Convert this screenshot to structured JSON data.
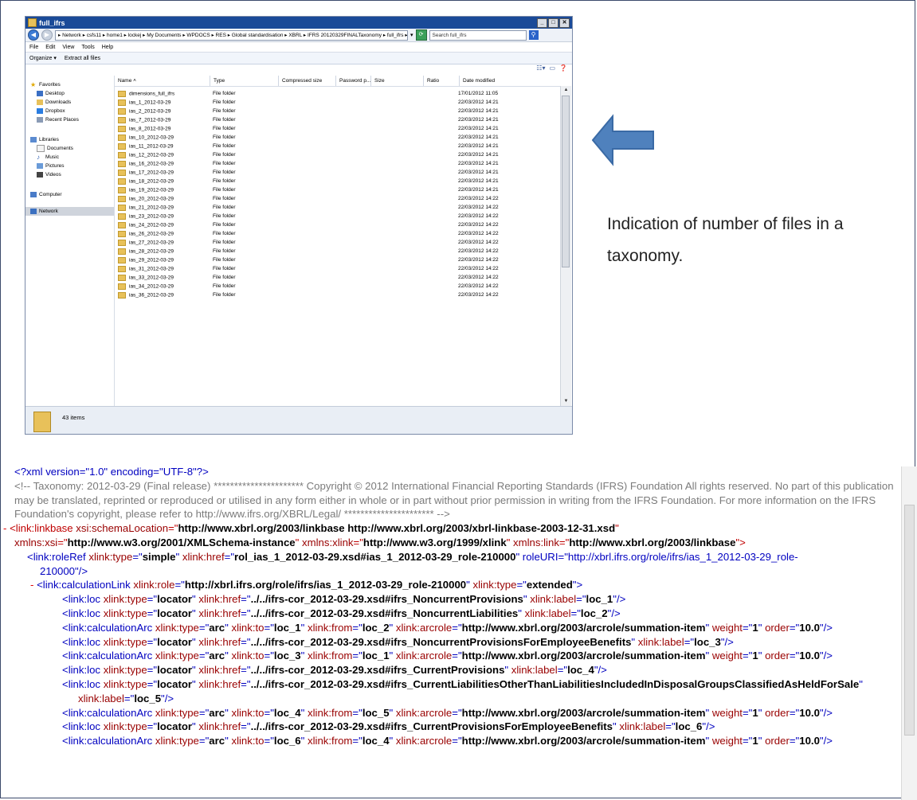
{
  "explorer": {
    "title": "full_ifrs",
    "address": "▸ Network ▸ csfs11 ▸ home1 ▸ lockej ▸ My Documents ▸ WPDOCS ▸ RES ▸ Global standardisation ▸ XBRL ▸ IFRS 20120329FINALTaxonomy ▸ full_ifrs ▸",
    "search_placeholder": "Search full_ifrs",
    "menu": [
      "File",
      "Edit",
      "View",
      "Tools",
      "Help"
    ],
    "toolbar": {
      "organize": "Organize ▾",
      "extract": "Extract all files"
    },
    "nav": {
      "favorites": "Favorites",
      "fav_items": [
        "Desktop",
        "Downloads",
        "Dropbox",
        "Recent Places"
      ],
      "libraries": "Libraries",
      "lib_items": [
        "Documents",
        "Music",
        "Pictures",
        "Videos"
      ],
      "computer": "Computer",
      "network": "Network"
    },
    "columns": [
      "Name ˄",
      "Type",
      "Compressed size",
      "Password p...",
      "Size",
      "Ratio",
      "Date modified"
    ],
    "files": [
      {
        "name": "dimensions_full_ifrs",
        "type": "File folder",
        "date": "17/01/2012 11:05"
      },
      {
        "name": "ias_1_2012-03-29",
        "type": "File folder",
        "date": "22/03/2012 14:21"
      },
      {
        "name": "ias_2_2012-03-29",
        "type": "File folder",
        "date": "22/03/2012 14:21"
      },
      {
        "name": "ias_7_2012-03-29",
        "type": "File folder",
        "date": "22/03/2012 14:21"
      },
      {
        "name": "ias_8_2012-03-29",
        "type": "File folder",
        "date": "22/03/2012 14:21"
      },
      {
        "name": "ias_10_2012-03-29",
        "type": "File folder",
        "date": "22/03/2012 14:21"
      },
      {
        "name": "ias_11_2012-03-29",
        "type": "File folder",
        "date": "22/03/2012 14:21"
      },
      {
        "name": "ias_12_2012-03-29",
        "type": "File folder",
        "date": "22/03/2012 14:21"
      },
      {
        "name": "ias_16_2012-03-29",
        "type": "File folder",
        "date": "22/03/2012 14:21"
      },
      {
        "name": "ias_17_2012-03-29",
        "type": "File folder",
        "date": "22/03/2012 14:21"
      },
      {
        "name": "ias_18_2012-03-29",
        "type": "File folder",
        "date": "22/03/2012 14:21"
      },
      {
        "name": "ias_19_2012-03-29",
        "type": "File folder",
        "date": "22/03/2012 14:21"
      },
      {
        "name": "ias_20_2012-03-29",
        "type": "File folder",
        "date": "22/03/2012 14:22"
      },
      {
        "name": "ias_21_2012-03-29",
        "type": "File folder",
        "date": "22/03/2012 14:22"
      },
      {
        "name": "ias_23_2012-03-29",
        "type": "File folder",
        "date": "22/03/2012 14:22"
      },
      {
        "name": "ias_24_2012-03-29",
        "type": "File folder",
        "date": "22/03/2012 14:22"
      },
      {
        "name": "ias_26_2012-03-29",
        "type": "File folder",
        "date": "22/03/2012 14:22"
      },
      {
        "name": "ias_27_2012-03-29",
        "type": "File folder",
        "date": "22/03/2012 14:22"
      },
      {
        "name": "ias_28_2012-03-29",
        "type": "File folder",
        "date": "22/03/2012 14:22"
      },
      {
        "name": "ias_29_2012-03-29",
        "type": "File folder",
        "date": "22/03/2012 14:22"
      },
      {
        "name": "ias_31_2012-03-29",
        "type": "File folder",
        "date": "22/03/2012 14:22"
      },
      {
        "name": "ias_33_2012-03-29",
        "type": "File folder",
        "date": "22/03/2012 14:22"
      },
      {
        "name": "ias_34_2012-03-29",
        "type": "File folder",
        "date": "22/03/2012 14:22"
      },
      {
        "name": "ias_36_2012-03-29",
        "type": "File folder",
        "date": "22/03/2012 14:22"
      }
    ],
    "status": "43 items"
  },
  "note": "Indication of number of files in a taxonomy.",
  "colors": {
    "arrow": "#4f81bd",
    "titlebar": "#1a4a98"
  },
  "xml": {
    "decl": "<?xml version=\"1.0\" encoding=\"UTF-8\"?>",
    "comment": "<!-- Taxonomy: 2012-03-29 (Final release) ********************** Copyright © 2012 International Financial Reporting Standards (IFRS) Foundation All rights reserved. No part of this publication may be translated, reprinted or reproduced or utilised in any form either in whole or in part without prior permission in writing from the IFRS Foundation. For more information on the IFRS Foundation's copyright, please refer to http://www.ifrs.org/XBRL/Legal/ ********************** -->",
    "linkbase_line1": "<link:linkbase xsi:schemaLocation=\"http://www.xbrl.org/2003/linkbase http://www.xbrl.org/2003/xbrl-linkbase-2003-12-31.xsd\"",
    "linkbase_line2": "xmlns:xsi=\"http://www.w3.org/2001/XMLSchema-instance\" xmlns:xlink=\"http://www.w3.org/1999/xlink\" xmlns:link=\"http://www.xbrl.org/2003/linkbase\">",
    "roleref_line1": "<link:roleRef xlink:type=\"simple\" xlink:href=\"rol_ias_1_2012-03-29.xsd#ias_1_2012-03-29_role-210000\" roleURI=\"http://xbrl.ifrs.org/role/ifrs/ias_1_2012-03-29_role-",
    "roleref_line2": "210000\"/>",
    "calclink": "<link:calculationLink xlink:role=\"http://xbrl.ifrs.org/role/ifrs/ias_1_2012-03-29_role-210000\" xlink:type=\"extended\">",
    "lines": [
      "<link:loc xlink:type=\"locator\" xlink:href=\"../../ifrs-cor_2012-03-29.xsd#ifrs_NoncurrentProvisions\" xlink:label=\"loc_1\"/>",
      "<link:loc xlink:type=\"locator\" xlink:href=\"../../ifrs-cor_2012-03-29.xsd#ifrs_NoncurrentLiabilities\" xlink:label=\"loc_2\"/>",
      "<link:calculationArc xlink:type=\"arc\" xlink:to=\"loc_1\" xlink:from=\"loc_2\" xlink:arcrole=\"http://www.xbrl.org/2003/arcrole/summation-item\" weight=\"1\" order=\"10.0\"/>",
      "<link:loc xlink:type=\"locator\" xlink:href=\"../../ifrs-cor_2012-03-29.xsd#ifrs_NoncurrentProvisionsForEmployeeBenefits\" xlink:label=\"loc_3\"/>",
      "<link:calculationArc xlink:type=\"arc\" xlink:to=\"loc_3\" xlink:from=\"loc_1\" xlink:arcrole=\"http://www.xbrl.org/2003/arcrole/summation-item\" weight=\"1\" order=\"10.0\"/>",
      "<link:loc xlink:type=\"locator\" xlink:href=\"../../ifrs-cor_2012-03-29.xsd#ifrs_CurrentProvisions\" xlink:label=\"loc_4\"/>",
      "<link:loc xlink:type=\"locator\" xlink:href=\"../../ifrs-cor_2012-03-29.xsd#ifrs_CurrentLiabilitiesOtherThanLiabilitiesIncludedInDisposalGroupsClassifiedAsHeldForSale\"",
      "xlink:label=\"loc_5\"/>",
      "<link:calculationArc xlink:type=\"arc\" xlink:to=\"loc_4\" xlink:from=\"loc_5\" xlink:arcrole=\"http://www.xbrl.org/2003/arcrole/summation-item\" weight=\"1\" order=\"10.0\"/>",
      "<link:loc xlink:type=\"locator\" xlink:href=\"../../ifrs-cor_2012-03-29.xsd#ifrs_CurrentProvisionsForEmployeeBenefits\" xlink:label=\"loc_6\"/>",
      "<link:calculationArc xlink:type=\"arc\" xlink:to=\"loc_6\" xlink:from=\"loc_4\" xlink:arcrole=\"http://www.xbrl.org/2003/arcrole/summation-item\" weight=\"1\" order=\"10.0\"/>"
    ]
  }
}
